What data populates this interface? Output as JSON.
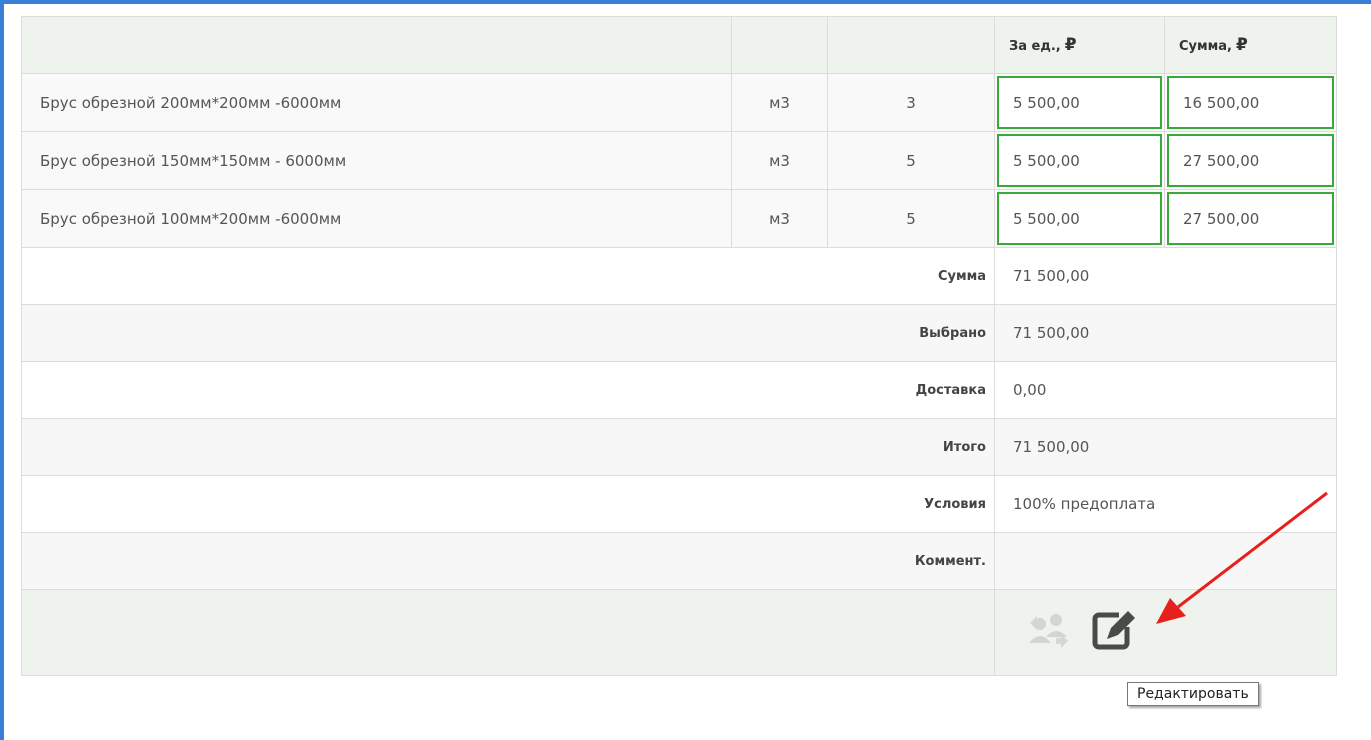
{
  "table": {
    "headers": {
      "price_per_unit": "За ед.,",
      "sum": "Сумма,",
      "currency_symbol": "₽"
    },
    "items": [
      {
        "name": "Брус обрезной 200мм*200мм -6000мм",
        "unit": "м3",
        "qty": "3",
        "price": "5 500,00",
        "total": "16 500,00"
      },
      {
        "name": "Брус обрезной 150мм*150мм - 6000мм",
        "unit": "м3",
        "qty": "5",
        "price": "5 500,00",
        "total": "27 500,00"
      },
      {
        "name": "Брус обрезной 100мм*200мм -6000мм",
        "unit": "м3",
        "qty": "5",
        "price": "5 500,00",
        "total": "27 500,00"
      }
    ],
    "summary": [
      {
        "label": "Сумма",
        "value": "71 500,00"
      },
      {
        "label": "Выбрано",
        "value": "71 500,00"
      },
      {
        "label": "Доставка",
        "value": "0,00"
      },
      {
        "label": "Итого",
        "value": "71 500,00"
      },
      {
        "label": "Условия",
        "value": "100% предоплата"
      },
      {
        "label": "Коммент.",
        "value": ""
      }
    ]
  },
  "actions": {
    "icons": [
      "users-swap-icon",
      "edit-icon"
    ],
    "edit_tooltip": "Редактировать"
  },
  "colors": {
    "accent_green": "#3aa83a",
    "frame_blue": "#3a7fd5",
    "annotation_red": "#e8201c"
  }
}
